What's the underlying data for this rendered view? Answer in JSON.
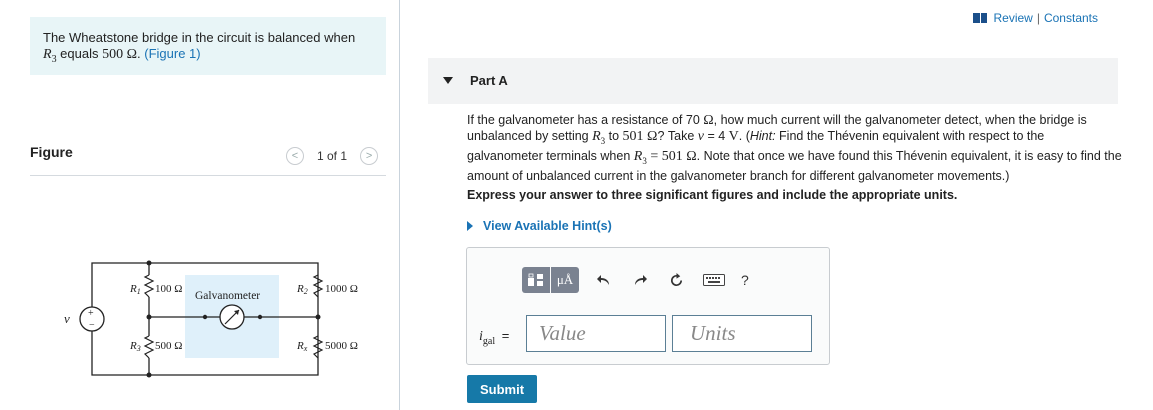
{
  "intro": {
    "text_before": "The Wheatstone bridge in the circuit is balanced when",
    "r3_symbol": "R",
    "r3_sub": "3",
    "text_mid": " equals ",
    "r3_value": "500 Ω",
    "period": ".",
    "figure_link": "(Figure 1)"
  },
  "figure": {
    "title": "Figure",
    "pager_prev": "<",
    "pager_count": "1 of 1",
    "pager_next": ">"
  },
  "circuit": {
    "r1_label": "R",
    "r1_sub": "1",
    "r1_value": "100 Ω",
    "r2_label": "R",
    "r2_sub": "2",
    "r2_value": "1000 Ω",
    "r3_label": "R",
    "r3_sub": "3",
    "r3_value": "500 Ω",
    "rx_label": "R",
    "rx_sub": "x",
    "rx_value": "5000 Ω",
    "galvanometer_label": "Galvanometer",
    "source_label": "v",
    "source_plus": "+",
    "source_minus": "−"
  },
  "header": {
    "review": "Review",
    "separator": "|",
    "constants": "Constants"
  },
  "part": {
    "title": "Part A"
  },
  "question": {
    "s1": "If the galvanometer has a resistance of 70 ",
    "s2": "Ω",
    "s3": ", how much current will the galvanometer detect, when the bridge is unbalanced by setting ",
    "s4": "R",
    "s5": "3",
    "s6": " to ",
    "s7": "501 Ω",
    "s8": "? Take ",
    "s9": "v",
    "s10": " = 4 ",
    "s11": "V",
    "s12": ". (",
    "s13": "Hint:",
    "s14": " Find the Thévenin equivalent with respect to the galvanometer terminals when ",
    "s15": "R",
    "s16": "3",
    "s17": " = 501 Ω",
    "s18": ". Note that once we have found this Thévenin equivalent, it is easy to find the amount of unbalanced current in the galvanometer branch for different galvanometer movements.)"
  },
  "express": "Express your answer to three significant figures and include the appropriate units.",
  "hints": "View Available Hint(s)",
  "answer": {
    "var_symbol": "i",
    "var_sub": "gal",
    "equals": "=",
    "value_placeholder": "Value",
    "units_placeholder": "Units",
    "units_button": "μÅ",
    "help": "?"
  },
  "submit": "Submit",
  "colors": {
    "accent": "#1a73b5",
    "submit_bg": "#1679a8",
    "intro_bg": "#e8f5f7",
    "galvanometer_bg": "#dff0fa"
  }
}
